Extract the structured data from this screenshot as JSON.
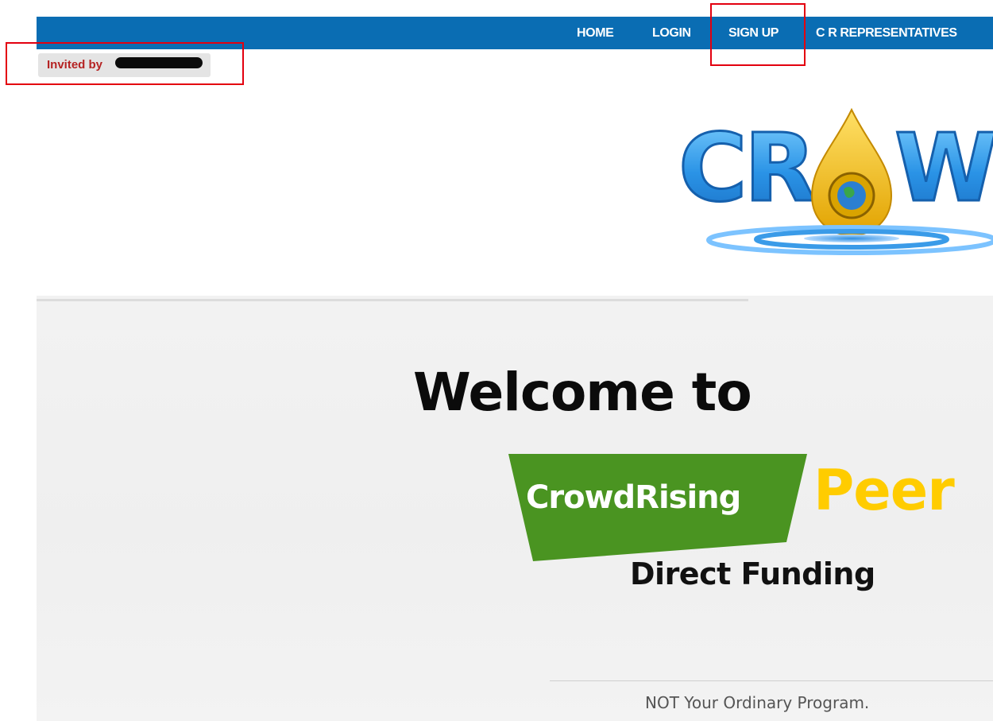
{
  "nav": {
    "items": [
      {
        "label": "HOME"
      },
      {
        "label": "LOGIN"
      },
      {
        "label": "SIGN UP"
      },
      {
        "label": "C R REPRESENTATIVES"
      }
    ]
  },
  "invite": {
    "prefix": "Invited by",
    "name_redacted": true
  },
  "logo": {
    "text": "CROWD"
  },
  "hero": {
    "welcome": "Welcome to",
    "brand": "CrowdRising",
    "peer": "Peer",
    "subtitle": "Direct Funding",
    "tagline": "NOT Your Ordinary Program."
  },
  "colors": {
    "nav_bg": "#0a6db3",
    "invite_text": "#b52323",
    "brand_green": "#4a9421",
    "peer_yellow": "#ffcc00",
    "highlight_red": "#e3000f"
  }
}
